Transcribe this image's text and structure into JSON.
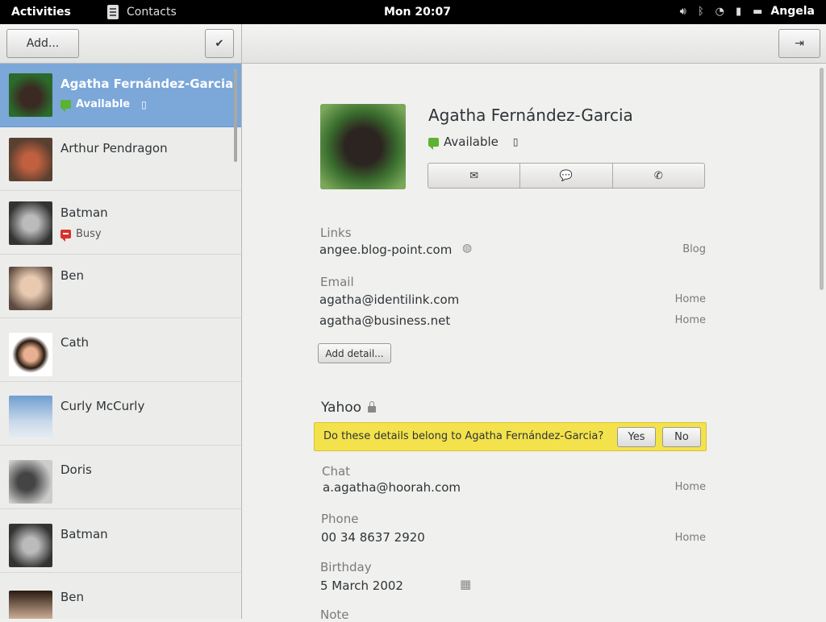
{
  "topbar": {
    "activities": "Activities",
    "app_name": "Contacts",
    "clock": "Mon 20:07",
    "user": "Angela",
    "icons": [
      "volume-icon",
      "bluetooth-icon",
      "wifi-icon",
      "battery-icon",
      "chat-icon"
    ]
  },
  "toolbar": {
    "add_label": "Add...",
    "done_glyph": "✔",
    "exit_glyph": "⇥"
  },
  "contacts": [
    {
      "name": "Agatha Fernández-Garcia",
      "status": "Available",
      "status_color": "#5cb331",
      "selected": true
    },
    {
      "name": "Arthur Pendragon"
    },
    {
      "name": "Batman",
      "status": "Busy",
      "status_color": "#d9312b"
    },
    {
      "name": "Ben"
    },
    {
      "name": "Cath"
    },
    {
      "name": "Curly McCurly"
    },
    {
      "name": "Doris"
    },
    {
      "name": "Batman"
    },
    {
      "name": "Ben"
    }
  ],
  "detail": {
    "name": "Agatha Fernández-Garcia",
    "status": "Available",
    "actions": [
      "✉",
      "💬",
      "✆"
    ],
    "links_label": "Links",
    "link_value": "angee.blog-point.com",
    "link_tag": "Blog",
    "email_label": "Email",
    "emails": [
      {
        "value": "agatha@identilink.com",
        "tag": "Home"
      },
      {
        "value": "agatha@business.net",
        "tag": "Home"
      }
    ],
    "add_detail": "Add detail...",
    "yahoo_label": "Yahoo",
    "linking_question": "Do these details belong to Agatha Fernández-Garcia?",
    "yes": "Yes",
    "no": "No",
    "chat_label": "Chat",
    "chat_value": "a.agatha@hoorah.com",
    "chat_tag": "Home",
    "phone_label": "Phone",
    "phone_value": "00 34 8637 2920",
    "phone_tag": "Home",
    "birthday_label": "Birthday",
    "birthday_value": "5 March 2002",
    "note_label": "Note"
  },
  "colors": {
    "selection": "#7ba7d9",
    "available": "#5cb331",
    "busy": "#d9312b",
    "infobar": "#f3e24b"
  }
}
